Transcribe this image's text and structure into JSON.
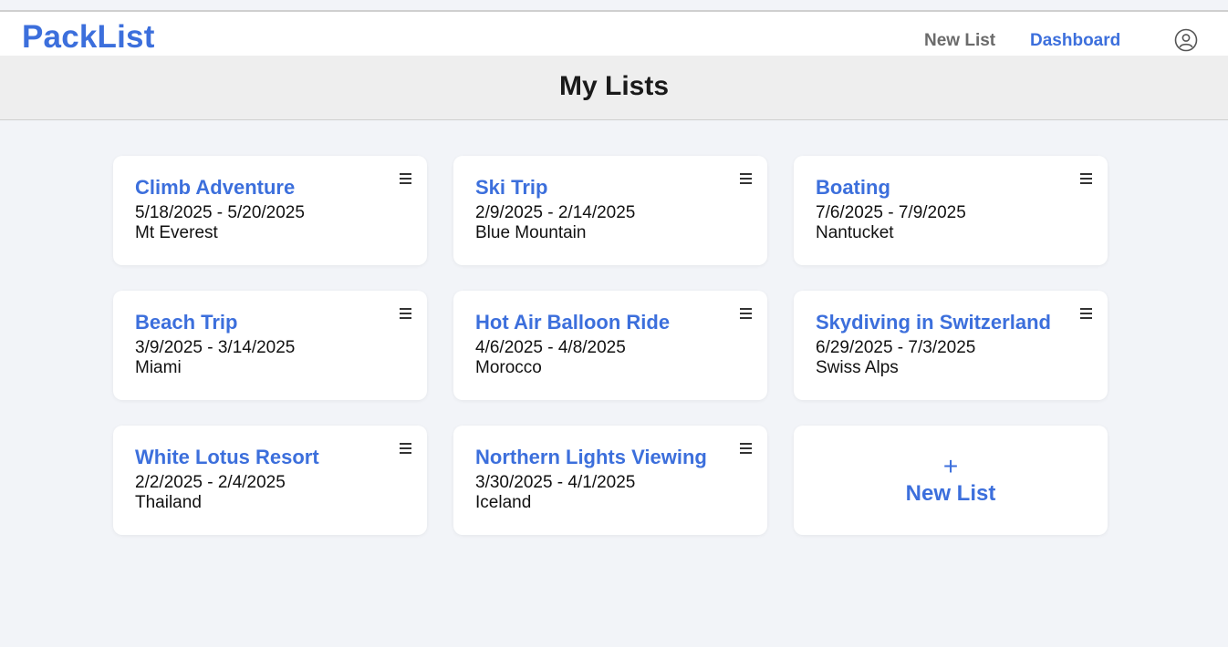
{
  "app": {
    "logo": "PackList",
    "nav": {
      "new_list": "New List",
      "dashboard": "Dashboard"
    },
    "accent_color": "#3c6fdc",
    "avatar_icon": "user-circle-icon"
  },
  "page": {
    "title": "My Lists"
  },
  "lists": [
    {
      "title": "Climb Adventure",
      "dates": "5/18/2025 - 5/20/2025",
      "location": "Mt Everest"
    },
    {
      "title": "Ski Trip",
      "dates": "2/9/2025 - 2/14/2025",
      "location": "Blue Mountain"
    },
    {
      "title": "Boating",
      "dates": "7/6/2025 - 7/9/2025",
      "location": "Nantucket"
    },
    {
      "title": "Beach Trip",
      "dates": "3/9/2025 - 3/14/2025",
      "location": "Miami"
    },
    {
      "title": "Hot Air Balloon Ride",
      "dates": "4/6/2025 - 4/8/2025",
      "location": "Morocco"
    },
    {
      "title": "Skydiving in Switzerland",
      "dates": "6/29/2025 - 7/3/2025",
      "location": "Swiss Alps"
    },
    {
      "title": "White Lotus Resort",
      "dates": "2/2/2025 - 2/4/2025",
      "location": "Thailand"
    },
    {
      "title": "Northern Lights Viewing",
      "dates": "3/30/2025 - 4/1/2025",
      "location": "Iceland"
    }
  ],
  "new_card": {
    "plus": "+",
    "label": "New List"
  },
  "card_menu_icon": "hamburger-menu-icon"
}
